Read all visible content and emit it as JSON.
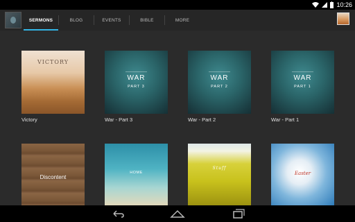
{
  "status_bar": {
    "time": "10:26",
    "icons": [
      "wifi-icon",
      "signal-icon",
      "battery-icon"
    ]
  },
  "action_bar": {
    "app_icon": "app-logo-icon",
    "tabs": [
      {
        "label": "SERMONS",
        "active": true
      },
      {
        "label": "BLOG",
        "active": false
      },
      {
        "label": "EVENTS",
        "active": false
      },
      {
        "label": "BIBLE",
        "active": false
      },
      {
        "label": "MORE",
        "active": false
      }
    ],
    "accent_color": "#33b5e5"
  },
  "sermons": [
    {
      "caption": "Victory",
      "thumb_title": "VICTORY",
      "thumb_sub": ""
    },
    {
      "caption": "War - Part 3",
      "thumb_title": "WAR",
      "thumb_sub": "PART 3"
    },
    {
      "caption": "War - Part 2",
      "thumb_title": "WAR",
      "thumb_sub": "PART 2"
    },
    {
      "caption": "War - Part 1",
      "thumb_title": "WAR",
      "thumb_sub": "PART 1"
    },
    {
      "caption": "",
      "thumb_title": "Discontent",
      "thumb_sub": ""
    },
    {
      "caption": "",
      "thumb_title": "HOME",
      "thumb_sub": ""
    },
    {
      "caption": "",
      "thumb_title": "Stuff",
      "thumb_sub": ""
    },
    {
      "caption": "",
      "thumb_title": "Easter",
      "thumb_sub": ""
    }
  ],
  "nav_bar": {
    "icons": [
      "back-icon",
      "home-icon",
      "recent-apps-icon"
    ]
  }
}
